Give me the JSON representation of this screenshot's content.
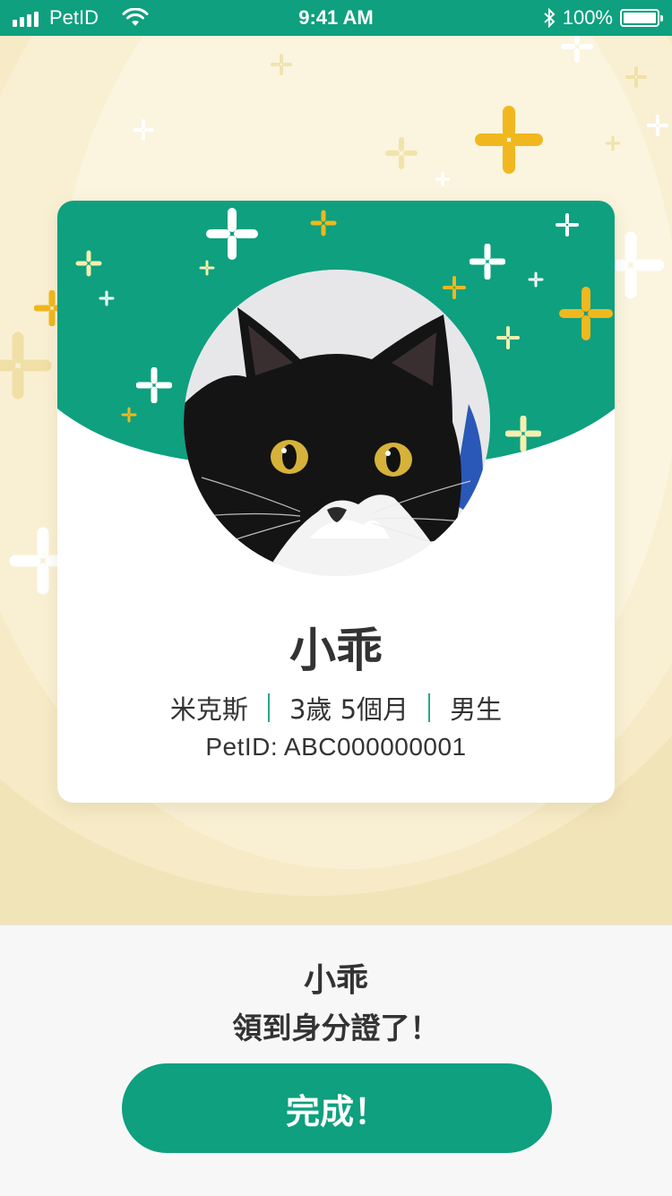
{
  "status_bar": {
    "carrier": "PetID",
    "time": "9:41 AM",
    "battery": "100%"
  },
  "card": {
    "pet_name": "小乖",
    "breed": "米克斯",
    "age": "3歲 5個月",
    "gender": "男生",
    "pet_id": "PetID: ABC000000001",
    "photo": "black-and-white-cat-photo"
  },
  "message": {
    "name": "小乖",
    "text": "領到身分證了！"
  },
  "done_button": {
    "label": "完成！"
  },
  "colors": {
    "brand_green": "#0ea07f",
    "beige": "#f1e4b8",
    "sparkle_yellow": "#f0b81e",
    "sparkle_pale": "#f4efb0"
  }
}
